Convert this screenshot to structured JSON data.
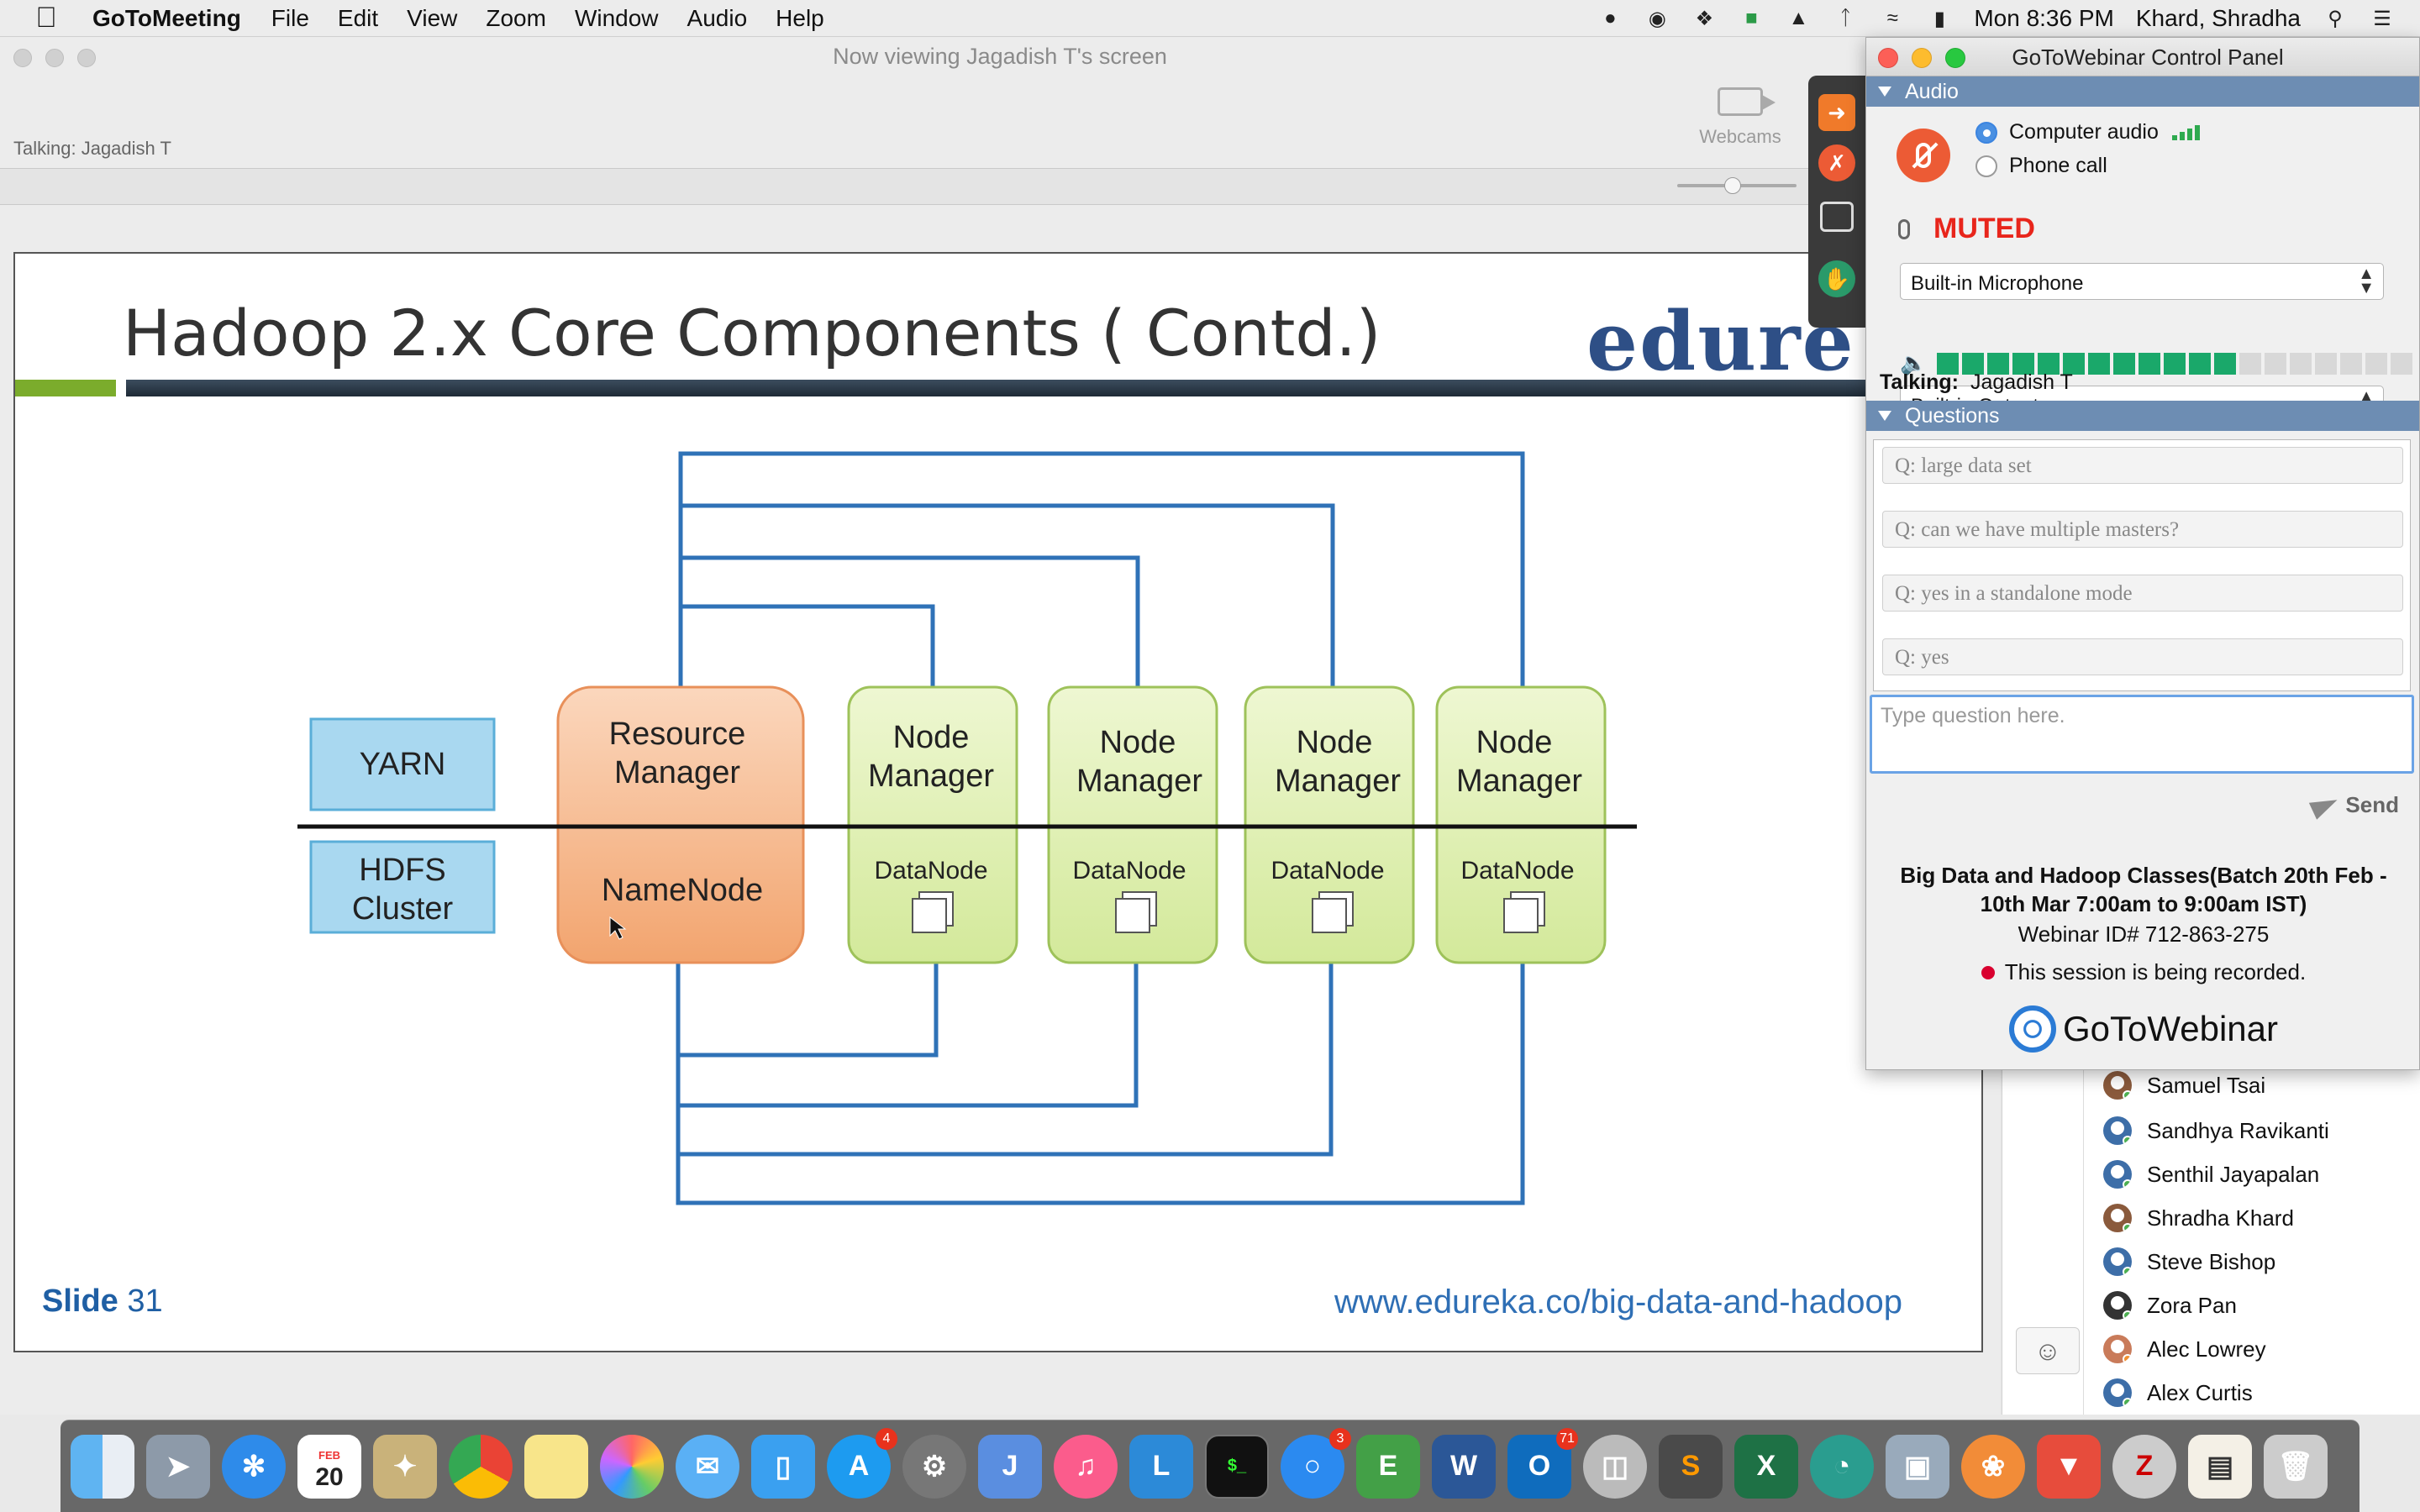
{
  "menubar": {
    "app_name": "GoToMeeting",
    "menus": [
      "File",
      "Edit",
      "View",
      "Zoom",
      "Window",
      "Audio",
      "Help"
    ],
    "clock": "Mon 8:36 PM",
    "user": "Khard, Shradha"
  },
  "meeting": {
    "window_title": "Now viewing Jagadish T's screen",
    "talking": "Talking: Jagadish T",
    "webcams_label": "Webcams"
  },
  "slide": {
    "title": "Hadoop 2.x Core Components ( Contd.)",
    "logo_text": "edure",
    "slide_label": "Slide",
    "slide_number": "31",
    "url": "www.edureka.co/big-data-and-hadoop",
    "diagram": {
      "yarn": "YARN",
      "hdfs_line1": "HDFS",
      "hdfs_line2": "Cluster",
      "rm_line1": "Resource",
      "rm_line2": "Manager",
      "namenode": "NameNode",
      "nm_line1": "Node",
      "nm_line2": "Manager",
      "datanode": "DataNode",
      "colors": {
        "blue": "#2f72b7",
        "orange": "#f4b183",
        "green": "#d8ecab",
        "yarn_fill": "#a9d8f0"
      }
    }
  },
  "participants": [
    "Samuel Tsai",
    "Sandhya Ravikanti",
    "Senthil Jayapalan",
    "Shradha Khard",
    "Steve Bishop",
    "Zora Pan",
    "Alec Lowrey",
    "Alex Curtis"
  ],
  "panel": {
    "title": "GoToWebinar Control Panel",
    "audio_header": "Audio",
    "computer_audio": "Computer audio",
    "phone_call": "Phone call",
    "muted": "MUTED",
    "microphone": "Built-in Microphone",
    "output": "Built-in Output",
    "talking_label": "Talking:",
    "talking_name": "Jagadish T",
    "questions_header": "Questions",
    "questions": [
      "Q: large data set",
      "Q: can we have multiple masters?",
      "Q: yes in a standalone mode",
      "Q: yes"
    ],
    "question_placeholder": "Type question here.",
    "send": "Send",
    "webinar_name": "Big Data and Hadoop Classes(Batch 20th Feb - 10th Mar 7:00am to 9:00am IST)",
    "webinar_id": "Webinar ID# 712-863-275",
    "recording": "This session is being recorded.",
    "brand": "GoToWebinar",
    "volume_level": 0.62
  },
  "dock": {
    "calendar_month": "FEB",
    "calendar_day": "20",
    "badges": {
      "appstore": "4",
      "chat": "3",
      "outlook": "71"
    }
  }
}
